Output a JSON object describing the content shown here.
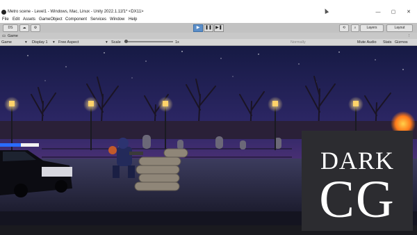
{
  "window": {
    "title": "Metro scene - Level1 - Windows, Mac, Linux - Unity 2022.1.11f1* <DX11>",
    "controls": [
      "—",
      "▢",
      "✕"
    ]
  },
  "menu": [
    "File",
    "Edit",
    "Assets",
    "GameObject",
    "Component",
    "Services",
    "Window",
    "Help"
  ],
  "toolbar": {
    "account": "DS",
    "layers": "Layers",
    "layout": "Layout",
    "play_icons": [
      "▶",
      "❚❚",
      "▶❚"
    ]
  },
  "game_tab": {
    "tab_label": "Game",
    "view_select": "Game",
    "display_select": "Display 1",
    "aspect_select": "Free Aspect",
    "scale_label": "Scale",
    "scale_value": "1x",
    "play_mode": "Normally",
    "mute_audio": "Mute Audio",
    "stats": "Stats",
    "gizmos": "Gizmos"
  },
  "watermark": {
    "top": "DARK",
    "bottom": "CG"
  },
  "colors": {
    "sky_top": "#1b1d4a",
    "sky_mid": "#3d2a6e",
    "sky_horizon": "#6a3a7a",
    "ground": "#2c2a44",
    "lamp": "#ffd36a",
    "watermark_bg": "#2c2c30"
  }
}
